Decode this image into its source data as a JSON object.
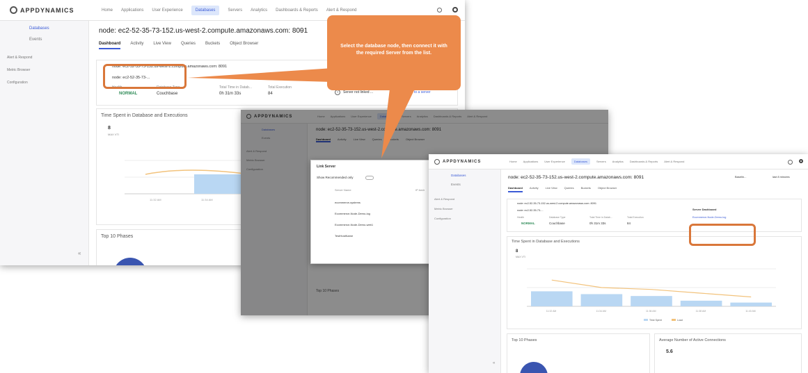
{
  "app": {
    "brand": "APPDYNAMICS"
  },
  "nav": [
    "Home",
    "Applications",
    "User Experience",
    "Databases",
    "Servers",
    "Analytics",
    "Dashboards & Reports",
    "Alert & Respond"
  ],
  "sidebar": {
    "primary": [
      "Databases",
      "Events"
    ],
    "secondary": [
      "Alert & Respond",
      "Metric Browser",
      "Configuration"
    ]
  },
  "node_title": "node: ec2-52-35-73-152.us-west-2.compute.amazonaws.com: 8091",
  "tabs": [
    "Dashboard",
    "Activity",
    "Live View",
    "Queries",
    "Buckets",
    "Object Browser"
  ],
  "node_box": {
    "name": "node: ec2-52-35-73-152.us-west-2.compute.amazonaws.com: 8091",
    "dropdown": "node: ec2-52-35-73-...",
    "health_label": "Health",
    "health_value": "NORMAL",
    "db_type_label": "Database Type",
    "db_type_value": "Couchbase",
    "time_label": "Total Time in Datab...",
    "time_value": "0h 31m 33s",
    "exec_label": "Total Execution",
    "exec_value": "84"
  },
  "server_info": {
    "text": "Server not linked ...",
    "link": "database to a server"
  },
  "server_dashboard": {
    "title": "Server Dashboard",
    "link": "Ecommerce-Node-Demo-log"
  },
  "chart_title": "Time Spent in Database and Executions",
  "chart_subtitle_top": "8",
  "chart_subtitle_bottom": "MAX VTI",
  "phases_title": "Top 10 Phases",
  "connections_title": "Average Number of Active Connections",
  "connections_value": "5.6",
  "callout": "Select the database node, then connect it with the required Server from the list.",
  "modal": {
    "title": "Link Server",
    "show_label": "Show Recommended only",
    "column": "Server Name",
    "column_right": "IP Addr",
    "items": [
      "ecommerce-systems",
      "Ecommerce-Node-Demo-log",
      "Ecommerce-Node-Demo-web1",
      "TestHostName"
    ]
  },
  "header_right": {
    "baseline": "Baselin...",
    "time_range": "last 8 minutes"
  },
  "chart_data": {
    "type": "bar",
    "title": "Time Spent in Database and Executions",
    "categories": [
      "11:32 AM",
      "11:34 AM",
      "11:36 AM",
      "11:38 AM",
      "11:40 AM"
    ],
    "series": [
      {
        "name": "Time Spent",
        "values": [
          8,
          6.5,
          5.5,
          3,
          2
        ]
      },
      {
        "name": "Load",
        "values": [
          7,
          5,
          4.5,
          3.5,
          2.5
        ]
      }
    ],
    "legend": [
      "Time Spent",
      "Load"
    ],
    "colors": {
      "Time Spent": "#b9d7f3",
      "Load": "#f2c27b"
    }
  }
}
